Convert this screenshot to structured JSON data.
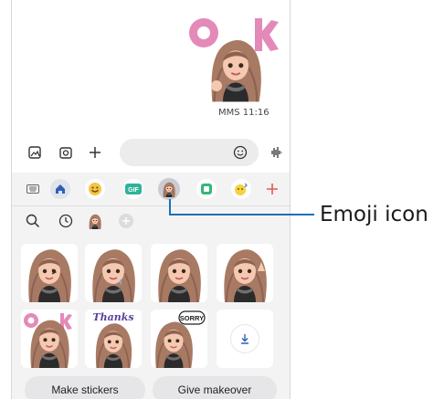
{
  "conversation": {
    "sticker_text": "OK",
    "message_meta": "MMS 11:16"
  },
  "composer": {
    "gallery_icon": "gallery-icon",
    "camera_icon": "camera-icon",
    "add_icon": "plus-icon",
    "emoji_icon": "smiley-icon",
    "voice_icon": "voice-waveform-icon"
  },
  "tray": {
    "tabs": [
      {
        "icon": "keyboard-icon"
      },
      {
        "icon": "home-icon"
      },
      {
        "icon": "emoji-smiley-icon"
      },
      {
        "label": "GIF"
      },
      {
        "icon": "ar-emoji-icon",
        "selected": true
      },
      {
        "icon": "sticker-icon"
      },
      {
        "icon": "animated-emoji-icon"
      },
      {
        "icon": "add-icon"
      }
    ],
    "subtabs": [
      {
        "icon": "search-icon"
      },
      {
        "icon": "recent-icon"
      },
      {
        "icon": "avatar-icon"
      },
      {
        "icon": "add-circle-icon"
      }
    ],
    "stickers": [
      {
        "row": 1,
        "col": 1,
        "caption": ""
      },
      {
        "row": 1,
        "col": 2,
        "caption": ""
      },
      {
        "row": 1,
        "col": 3,
        "caption": ""
      },
      {
        "row": 1,
        "col": 4,
        "caption": ""
      },
      {
        "row": 2,
        "col": 1,
        "caption": "OK"
      },
      {
        "row": 2,
        "col": 2,
        "caption": "Thanks"
      },
      {
        "row": 2,
        "col": 3,
        "caption": "SORRY"
      },
      {
        "row": 2,
        "col": 4,
        "caption": ""
      }
    ],
    "make_stickers_label": "Make stickers",
    "give_makeover_label": "Give makeover"
  },
  "annotation": {
    "callout": "Emoji icon"
  },
  "colors": {
    "accent_red": "#e8584f",
    "hair": "#a87a64",
    "ok_pink": "#e48ab8",
    "thanks_purple": "#5a3f9e",
    "gif_green": "#2fb39a",
    "home_blue": "#2c5fb8"
  }
}
